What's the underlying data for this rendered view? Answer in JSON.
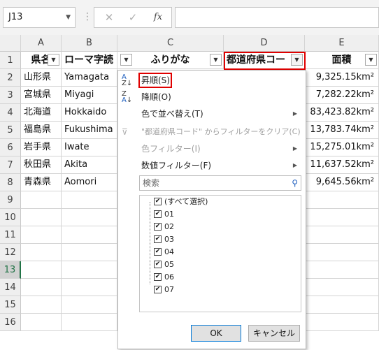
{
  "formula_bar": {
    "name_box": "J13",
    "cancel_icon": "✕",
    "enter_icon": "✓",
    "fx_icon": "fx",
    "more_dots": "⋮"
  },
  "columns": [
    "A",
    "B",
    "C",
    "D",
    "E"
  ],
  "rows": [
    "1",
    "2",
    "3",
    "4",
    "5",
    "6",
    "7",
    "8",
    "9",
    "10",
    "11",
    "12",
    "13",
    "14",
    "15",
    "16"
  ],
  "selected_row": "13",
  "headers": [
    "県名",
    "ローマ字読み",
    "ふりがな",
    "都道府県コード",
    "面積"
  ],
  "header_display": [
    "県名",
    "ローマ字読",
    "ふりがな",
    "都道府県コー",
    "面積"
  ],
  "table": [
    [
      "山形県",
      "Yamagata",
      "9,325.15km²"
    ],
    [
      "宮城県",
      "Miyagi",
      "7,282.22km²"
    ],
    [
      "北海道",
      "Hokkaido",
      "83,423.82km²"
    ],
    [
      "福島県",
      "Fukushima",
      "13,783.74km²"
    ],
    [
      "岩手県",
      "Iwate",
      "15,275.01km²"
    ],
    [
      "秋田県",
      "Akita",
      "11,637.52km²"
    ],
    [
      "青森県",
      "Aomori",
      "9,645.56km²"
    ]
  ],
  "filter_menu": {
    "sort_asc": "昇順(S)",
    "sort_desc": "降順(O)",
    "sort_by_color": "色で並べ替え(T)",
    "clear_filter": "\"都道府県コード\" からフィルターをクリア(C)",
    "color_filter": "色フィルター(I)",
    "number_filter": "数値フィルター(F)",
    "search_placeholder": "検索",
    "select_all": "(すべて選択)",
    "values": [
      "01",
      "02",
      "03",
      "04",
      "05",
      "06",
      "07"
    ],
    "ok": "OK",
    "cancel": "キャンセル"
  },
  "colors": {
    "highlight": "#e00000",
    "header_bg": "#efefef",
    "ok_border": "#0078d7"
  }
}
